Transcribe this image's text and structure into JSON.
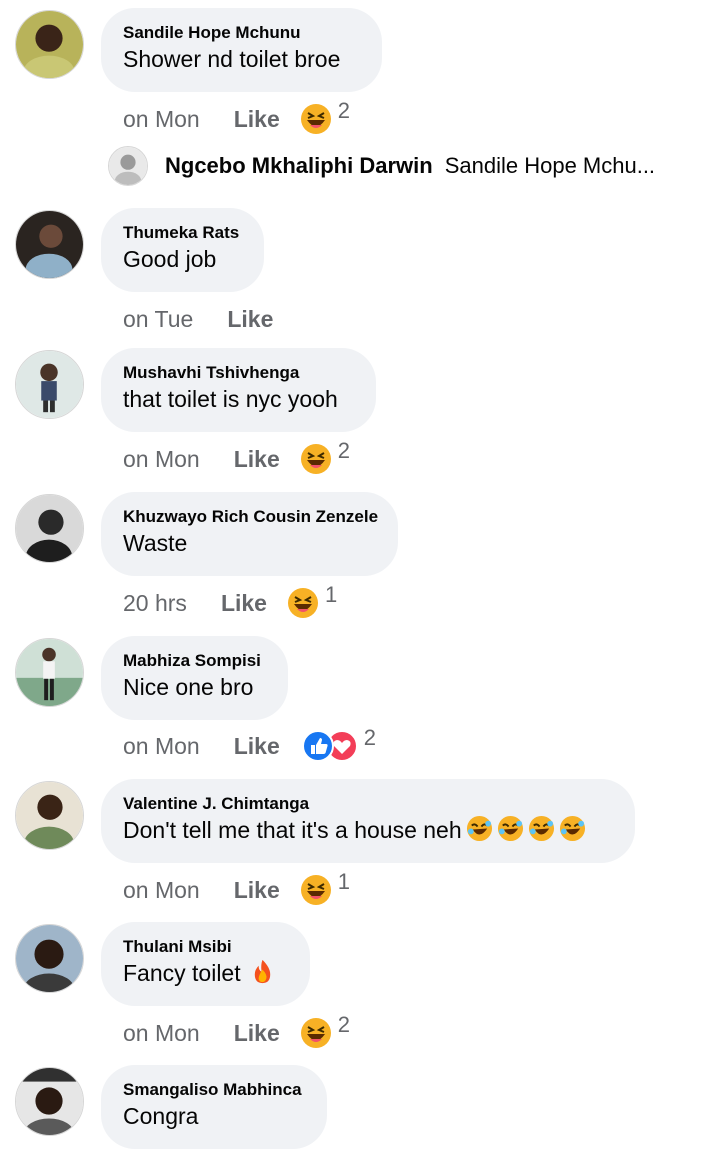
{
  "comments": [
    {
      "author": "Sandile Hope Mchunu",
      "text": "Shower nd toilet broe",
      "time": "on Mon",
      "like": "Like",
      "reaction": "laugh",
      "count": "2"
    },
    {
      "author": "Thumeka Rats",
      "text": "Good job",
      "time": "on Tue",
      "like": "Like",
      "reaction": "",
      "count": ""
    },
    {
      "author": "Mushavhi Tshivhenga",
      "text": "that toilet is nyc yooh",
      "time": "on Mon",
      "like": "Like",
      "reaction": "laugh",
      "count": "2"
    },
    {
      "author": "Khuzwayo Rich Cousin Zenzele",
      "text": "Waste",
      "time": "20 hrs",
      "like": "Like",
      "reaction": "laugh",
      "count": "1"
    },
    {
      "author": "Mabhiza Sompisi",
      "text": "Nice one bro",
      "time": "on Mon",
      "like": "Like",
      "reaction": "like-love",
      "count": "2"
    },
    {
      "author": "Valentine J. Chimtanga",
      "text": "Don't tell me that it's a house neh",
      "time": "on Mon",
      "like": "Like",
      "reaction": "laugh",
      "count": "1"
    },
    {
      "author": "Thulani Msibi",
      "text": "Fancy toilet",
      "time": "on Mon",
      "like": "Like",
      "reaction": "laugh",
      "count": "2"
    },
    {
      "author": "Smangaliso Mabhinca",
      "text": "Congra",
      "time": "",
      "like": "",
      "reaction": "",
      "count": ""
    }
  ],
  "reply": {
    "name": "Ngcebo Mkhaliphi Darwin",
    "snippet": "Sandile Hope Mchu..."
  },
  "icons": {
    "laugh": "laugh-reaction-icon",
    "love": "love-reaction-icon",
    "like": "like-reaction-icon",
    "rofl": "rofl-emoji-icon",
    "fire": "fire-emoji-icon"
  },
  "colors": {
    "bubble": "#f0f2f5",
    "meta": "#65676b",
    "text": "#050505",
    "like_blue": "#1877f2",
    "love_red": "#f33e58",
    "laugh_yellow": "#f7b125"
  }
}
